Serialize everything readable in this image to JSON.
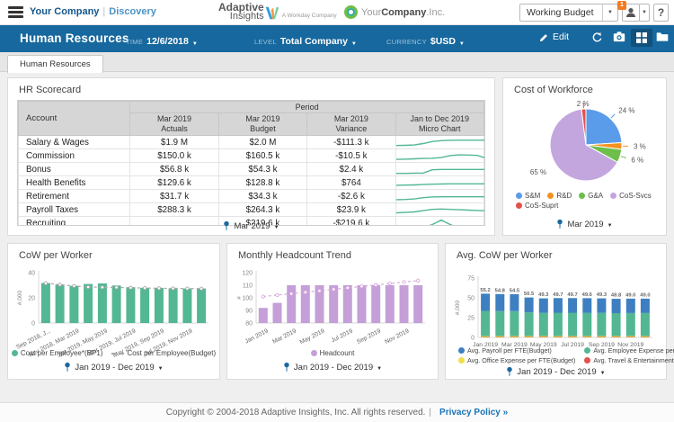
{
  "colors": {
    "header_blue": "#17689E",
    "accent_blue": "#1A69A0",
    "green": "#53B793",
    "gray_line": "#A9A9A9",
    "purple": "#C49FD8",
    "purple_trend": "#D9A9DC",
    "badge_orange": "#F47B20",
    "link_blue": "#1A73B5"
  },
  "topbar": {
    "brand": "Your Company",
    "brand_divider": "|",
    "nav_discovery": "Discovery",
    "logo_line1": "Adaptive",
    "logo_line2": "Insights",
    "logo_tagline": "A Workday Company",
    "company_pre": "Your",
    "company_bold": "Company",
    "company_suf": ".Inc.",
    "version_value": "Working Budget",
    "badge": "1",
    "help": "?"
  },
  "header": {
    "title": "Human Resources",
    "time_label": "TIME",
    "time_value": "12/6/2018",
    "level_label": "LEVEL",
    "level_value": "Total Company",
    "currency_label": "CURRENCY",
    "currency_value": "$USD",
    "edit": "Edit"
  },
  "tab": "Human Resources",
  "scorecard": {
    "title": "HR Scorecard",
    "col_account": "Account",
    "col_period": "Period",
    "sub_cols": [
      "Mar 2019\nActuals",
      "Mar 2019\nBudget",
      "Mar 2019\nVariance",
      "Jan to Dec 2019\nMicro Chart"
    ],
    "rows": [
      {
        "account": "Salary & Wages",
        "actuals": "$1.9 M",
        "budget": "$2.0 M",
        "variance": "-$111.3 k",
        "spark": [
          18,
          20,
          24,
          40,
          62,
          72,
          76,
          77,
          77,
          77,
          77,
          77
        ]
      },
      {
        "account": "Commission",
        "actuals": "$150.0 k",
        "budget": "$160.5 k",
        "variance": "-$10.5 k",
        "spark": [
          14,
          16,
          20,
          24,
          26,
          34,
          56,
          64,
          62,
          58,
          28,
          26
        ]
      },
      {
        "account": "Bonus",
        "actuals": "$56.8 k",
        "budget": "$54.3 k",
        "variance": "$2.4 k",
        "spark": [
          8,
          8,
          10,
          12,
          48,
          52,
          52,
          52,
          52,
          52,
          52,
          52
        ]
      },
      {
        "account": "Health Benefits",
        "actuals": "$129.6 k",
        "budget": "$128.8 k",
        "variance": "$764",
        "spark": [
          26,
          28,
          30,
          34,
          38,
          40,
          42,
          42,
          42,
          42,
          42,
          42
        ]
      },
      {
        "account": "Retirement",
        "actuals": "$31.7 k",
        "budget": "$34.3 k",
        "variance": "-$2.6 k",
        "spark": [
          16,
          18,
          24,
          38,
          46,
          48,
          48,
          48,
          48,
          48,
          48,
          48
        ]
      },
      {
        "account": "Payroll Taxes",
        "actuals": "$288.3 k",
        "budget": "$264.3 k",
        "variance": "$23.9 k",
        "spark": [
          20,
          24,
          30,
          44,
          58,
          62,
          58,
          54,
          50,
          46,
          42,
          40
        ]
      },
      {
        "account": "Recruiting",
        "actuals": "",
        "budget": "$219.6 k",
        "variance": "-$219.6 k",
        "spark": [
          2,
          2,
          2,
          2,
          40,
          88,
          40,
          2,
          2,
          2,
          2,
          2
        ]
      }
    ],
    "period_pin": "Mar 2019"
  },
  "chart_data": [
    {
      "type": "pie",
      "title": "Cost of Workforce",
      "labels": [
        "S&M",
        "R&D",
        "G&A",
        "CoS-Svcs",
        "CoS-Suprt"
      ],
      "values": [
        24,
        3,
        6,
        65,
        2
      ],
      "value_labels": [
        "24 %",
        "3 %",
        "6 %",
        "65 %",
        "2 %"
      ],
      "colors": [
        "#5A9BEA",
        "#F5921E",
        "#6DBE4B",
        "#C4A6DF",
        "#E4504B"
      ],
      "legend_position": "bottom",
      "period_pin": "Mar 2019"
    },
    {
      "type": "bar",
      "title": "CoW per Worker",
      "ylabel": "#,000",
      "ylim": [
        0,
        40
      ],
      "yticks": [
        0,
        20,
        40
      ],
      "x_labels": [
        "Sep 2018, J...",
        "Nov 2018, Mar 2019",
        "Jan 2019, May 2019",
        "Mar 2019, Jul 2019",
        "May 2019, Sep 2019",
        "Jul 2019, Nov 2019"
      ],
      "series": [
        {
          "name": "Cost per Employee*(BP1)",
          "type": "bar",
          "color": "#53B793",
          "values": [
            31.8,
            30.6,
            29.6,
            31.0,
            31.4,
            29.8,
            28.4,
            28.0,
            27.9,
            27.5,
            27.4,
            27.4
          ]
        },
        {
          "name": "Cost per Employee(Budget)",
          "type": "line",
          "dashed": true,
          "color": "#A9A9A9",
          "values": [
            31.6,
            30.4,
            29.4,
            28.6,
            28.4,
            28.3,
            28.0,
            27.8,
            27.6,
            27.5,
            27.4,
            27.3
          ]
        }
      ],
      "period_pin": "Jan 2019 - Dec 2019"
    },
    {
      "type": "bar",
      "title": "Monthly Headcount Trend",
      "ylabel": "#",
      "ylim": [
        80,
        120
      ],
      "yticks": [
        80,
        90,
        100,
        110,
        120
      ],
      "x_labels": [
        "Jan 2019",
        "Mar 2019",
        "May 2019",
        "Jul 2019",
        "Sep 2019",
        "Nov 2019"
      ],
      "series": [
        {
          "name": "Headcount",
          "type": "bar",
          "color": "#C49FD8",
          "values": [
            92,
            96,
            110,
            110,
            110,
            110,
            110,
            110,
            110,
            110,
            110,
            110
          ]
        },
        {
          "name": "Headcount trend",
          "type": "line",
          "dashed": true,
          "show_in_legend": false,
          "color": "#D9A9DC",
          "values": [
            101,
            102.2,
            103.3,
            104.5,
            105.6,
            106.8,
            107.9,
            109.1,
            110.2,
            111.4,
            112.5,
            113.7
          ]
        }
      ],
      "period_pin": "Jan 2019 - Dec 2019"
    },
    {
      "type": "stacked-bar",
      "title": "Avg. CoW per Worker",
      "ylabel": "#,000",
      "ylim": [
        0,
        75
      ],
      "yticks": [
        0,
        25,
        50,
        75
      ],
      "x_labels": [
        "Jan 2019",
        "Mar 2019",
        "May 2019",
        "Jul 2019",
        "Sep 2019",
        "Nov 2019"
      ],
      "total_labels": [
        "55.2",
        "54.8",
        "54.5",
        "50.5",
        "49.3",
        "49.7",
        "49.7",
        "49.6",
        "49.3",
        "48.8",
        "49.0",
        "49.0"
      ],
      "series": [
        {
          "name": "Avg. Travel & Entertainment per FTE(Budget)",
          "color": "#E4504B",
          "values": [
            0.6,
            0.6,
            0.6,
            0.6,
            0.6,
            0.6,
            0.6,
            0.6,
            0.6,
            0.6,
            0.6,
            0.6
          ]
        },
        {
          "name": "Avg. Office Expense per FTE(Budget)",
          "color": "#EFE049",
          "values": [
            1.1,
            1.1,
            1.1,
            1.1,
            1.1,
            1.1,
            1.1,
            1.1,
            1.1,
            1.1,
            1.1,
            1.1
          ]
        },
        {
          "name": "Avg. Employee Expense per FTE(Budget)",
          "color": "#53B793",
          "values": [
            31.8,
            31.6,
            31.4,
            30.0,
            29.3,
            29.5,
            29.5,
            29.4,
            29.3,
            29.0,
            29.1,
            29.1
          ]
        },
        {
          "name": "Avg. Payroll per FTE(Budget)",
          "color": "#3E7FC1",
          "values": [
            21.7,
            21.5,
            21.4,
            18.8,
            18.3,
            18.5,
            18.5,
            18.5,
            18.3,
            18.1,
            18.2,
            18.2
          ]
        }
      ],
      "period_pin": "Jan 2019 - Dec 2019"
    }
  ],
  "footer": {
    "copyright": "Copyright © 2004-2018 Adaptive Insights, Inc. All rights reserved.",
    "divider": "|",
    "privacy": "Privacy Policy »"
  }
}
